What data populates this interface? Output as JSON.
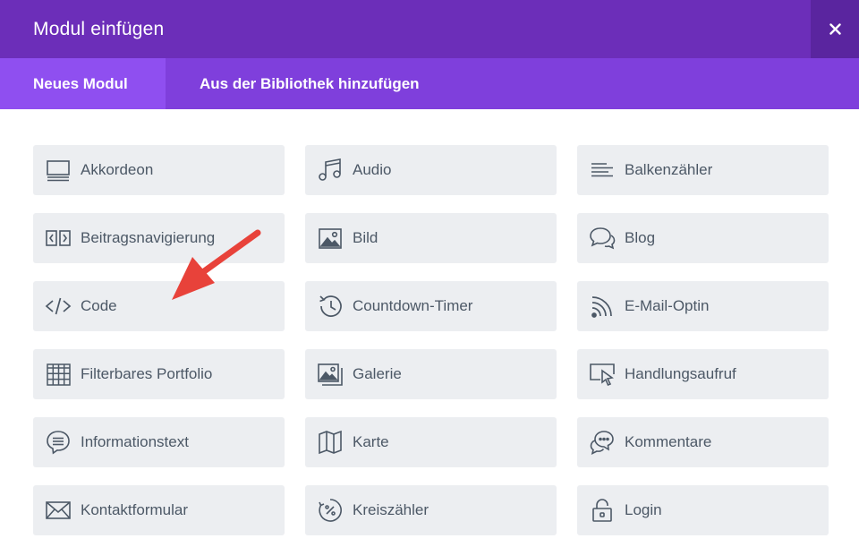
{
  "modal": {
    "title": "Modul einfügen",
    "close_icon": "close-icon"
  },
  "tabs": [
    {
      "label": "Neues Modul",
      "active": true
    },
    {
      "label": "Aus der Bibliothek hinzufügen",
      "active": false
    }
  ],
  "modules": [
    {
      "label": "Akkordeon",
      "icon": "accordion-icon"
    },
    {
      "label": "Audio",
      "icon": "music-note-icon"
    },
    {
      "label": "Balkenzähler",
      "icon": "bar-counter-icon"
    },
    {
      "label": "Beitragsnavigierung",
      "icon": "post-navigation-icon"
    },
    {
      "label": "Bild",
      "icon": "image-icon"
    },
    {
      "label": "Blog",
      "icon": "chat-bubbles-icon"
    },
    {
      "label": "Code",
      "icon": "code-icon"
    },
    {
      "label": "Countdown-Timer",
      "icon": "clock-history-icon"
    },
    {
      "label": "E-Mail-Optin",
      "icon": "rss-icon"
    },
    {
      "label": "Filterbares Portfolio",
      "icon": "grid-table-icon"
    },
    {
      "label": "Galerie",
      "icon": "gallery-icon"
    },
    {
      "label": "Handlungsaufruf",
      "icon": "cursor-screen-icon"
    },
    {
      "label": "Informationstext",
      "icon": "speech-bubble-lines-icon"
    },
    {
      "label": "Karte",
      "icon": "map-icon"
    },
    {
      "label": "Kommentare",
      "icon": "comments-icon"
    },
    {
      "label": "Kontaktformular",
      "icon": "envelope-icon"
    },
    {
      "label": "Kreiszähler",
      "icon": "circle-percent-icon"
    },
    {
      "label": "Login",
      "icon": "padlock-icon"
    }
  ],
  "colors": {
    "header_bg": "#6c2eb9",
    "tab_bar_bg": "#7f3fdc",
    "tab_active_bg": "#8f4ff0",
    "module_bg": "#eceef1",
    "module_text": "#4c5866",
    "annotation_arrow": "#e8423a"
  },
  "annotation": {
    "icon": "red-arrow-icon",
    "points_to": "Code"
  }
}
